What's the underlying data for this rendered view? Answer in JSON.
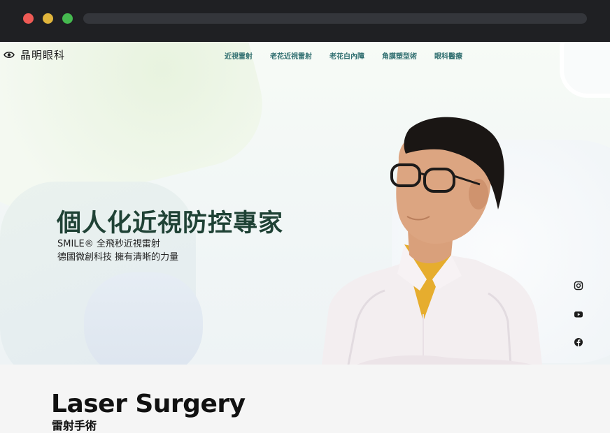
{
  "brand": {
    "name": "晶明眼科",
    "icon": "eye-icon"
  },
  "nav": {
    "items": [
      {
        "label": "近視雷射"
      },
      {
        "label": "老花近視雷射"
      },
      {
        "label": "老花白內障"
      },
      {
        "label": "角膜塑型術"
      },
      {
        "label": "眼科醫療"
      }
    ],
    "link_color": "#2f6e6f"
  },
  "hero": {
    "title": "個人化近視防控專家",
    "subtitle_line1": "SMILE® 全飛秒近視雷射",
    "subtitle_line2": "德國微創科技 擁有清晰的力量",
    "title_color": "#1f4235"
  },
  "social": {
    "icons": [
      "instagram-icon",
      "youtube-icon",
      "facebook-icon"
    ]
  },
  "section": {
    "title": "Laser Surgery",
    "subtitle": "雷射手術"
  },
  "colors": {
    "chrome_bg": "#1f2023",
    "dot_red": "#ee5a55",
    "dot_yellow": "#e0b53c",
    "dot_green": "#45b94f"
  }
}
